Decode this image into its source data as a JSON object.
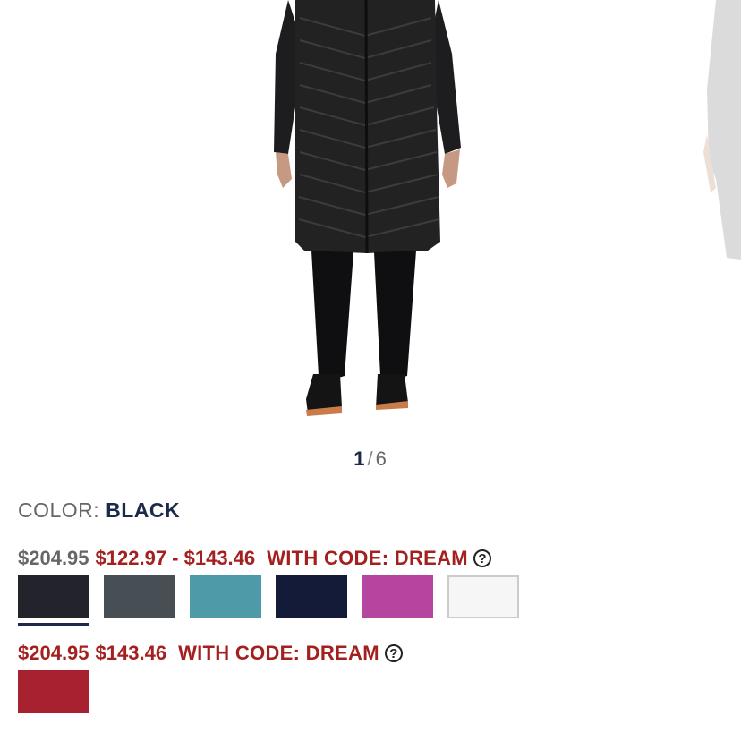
{
  "pager": {
    "current": "1",
    "separator": "/",
    "total": "6"
  },
  "color": {
    "label": "COLOR:",
    "value": "BLACK"
  },
  "group1": {
    "original_price": "$204.95",
    "sale_price": "$122.97 - $143.46",
    "promo": "WITH CODE: DREAM",
    "help_icon": "?",
    "swatches": [
      {
        "name": "black",
        "color": "#23242b",
        "selected": true
      },
      {
        "name": "charcoal",
        "color": "#474f54",
        "selected": false
      },
      {
        "name": "teal",
        "color": "#4e9aa9",
        "selected": false
      },
      {
        "name": "navy",
        "color": "#141b38",
        "selected": false
      },
      {
        "name": "magenta",
        "color": "#b6459f",
        "selected": false
      },
      {
        "name": "white",
        "color": "#f6f6f6",
        "selected": false
      }
    ]
  },
  "group2": {
    "original_price": "$204.95",
    "sale_price": "$143.46",
    "promo": "WITH CODE: DREAM",
    "help_icon": "?",
    "swatches": [
      {
        "name": "red",
        "color": "#a82131",
        "selected": false
      }
    ]
  },
  "colors": {
    "accent_red": "#a3201f",
    "navy_text": "#1b2a4a",
    "selected_underline": "#1b2a4a"
  }
}
